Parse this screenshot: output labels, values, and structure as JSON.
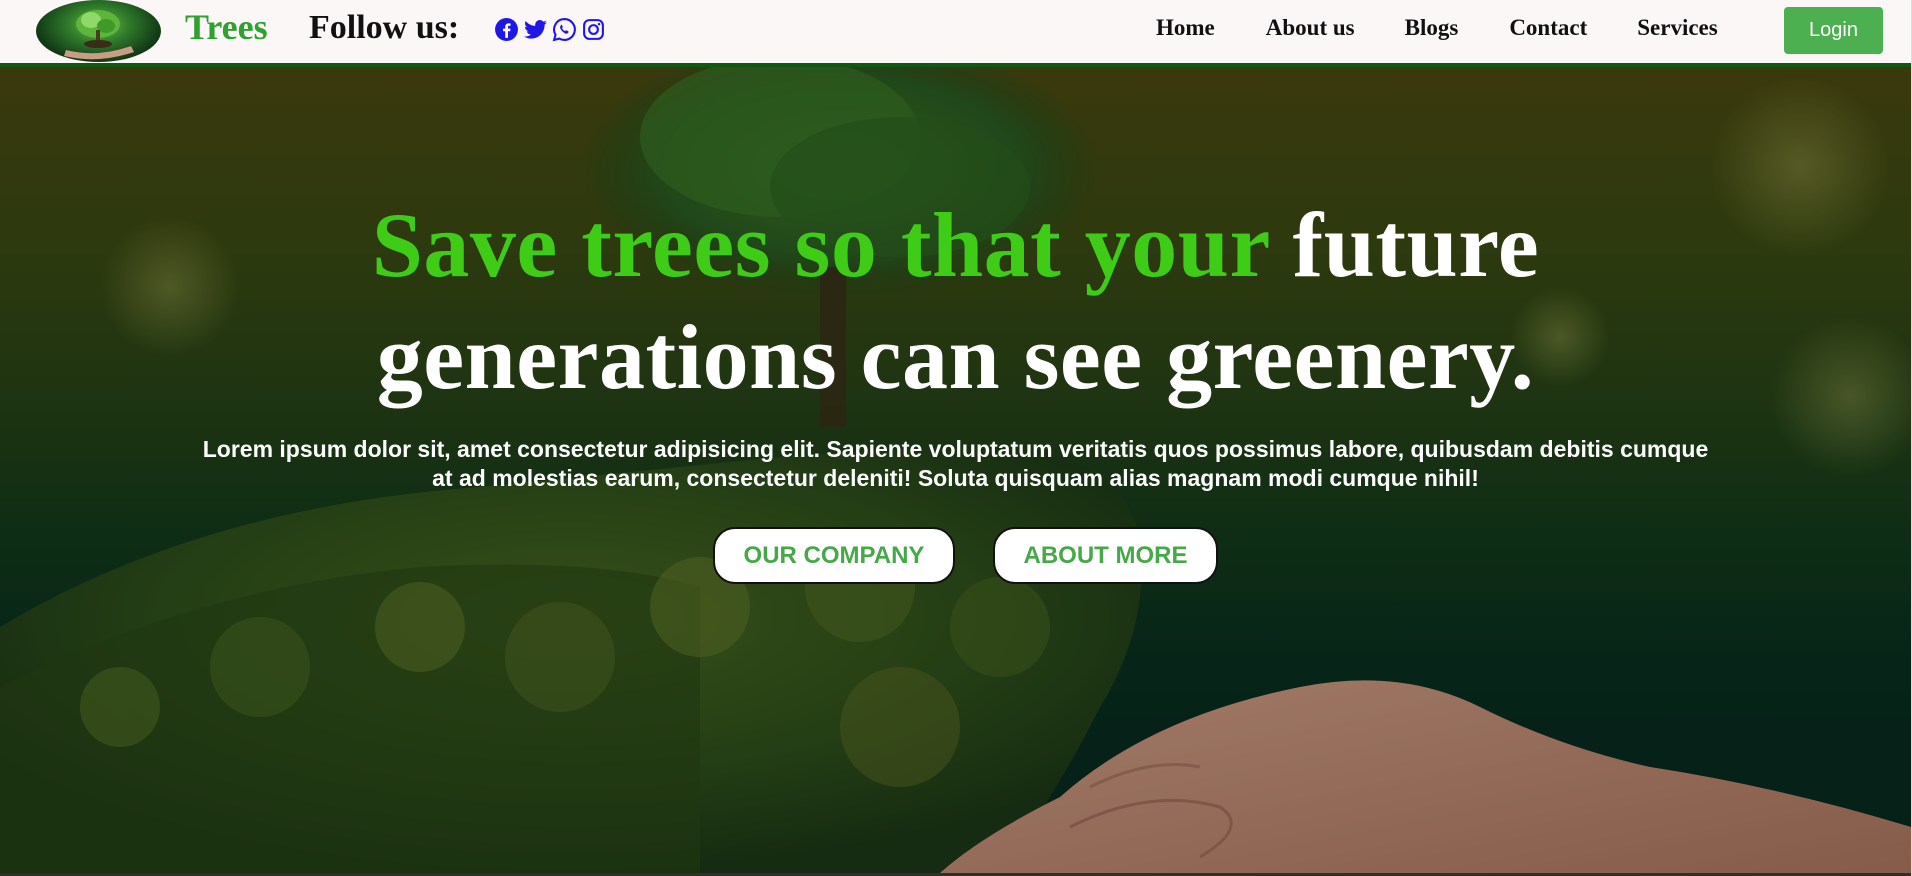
{
  "header": {
    "brand": "Trees",
    "follow_label": "Follow us:",
    "social": [
      {
        "icon": "facebook-icon",
        "color": "#1f17e6"
      },
      {
        "icon": "twitter-icon",
        "color": "#1f17e6"
      },
      {
        "icon": "whatsapp-icon",
        "color": "#1f17e6"
      },
      {
        "icon": "instagram-icon",
        "color": "#1f17e6"
      }
    ],
    "nav": [
      "Home",
      "About us",
      "Blogs",
      "Contact",
      "Services"
    ],
    "login_label": "Login"
  },
  "hero": {
    "headline_green": "Save trees so that your",
    "headline_white_1": " future",
    "headline_white_2": "generations can see greenery.",
    "text": "Lorem ipsum dolor sit, amet consectetur adipisicing elit. Sapiente voluptatum veritatis quos possimus labore, quibusdam debitis cumque at ad molestias earum, consectetur deleniti! Soluta quisquam alias magnam modi cumque nihil!",
    "buttons": [
      "OUR COMPANY",
      "ABOUT MORE"
    ]
  },
  "colors": {
    "brand_green": "#2ea12e",
    "headline_green": "#3fcc17",
    "login_bg": "#4caf50",
    "nav_border": "#0f5a13",
    "button_text": "#47a84a"
  }
}
